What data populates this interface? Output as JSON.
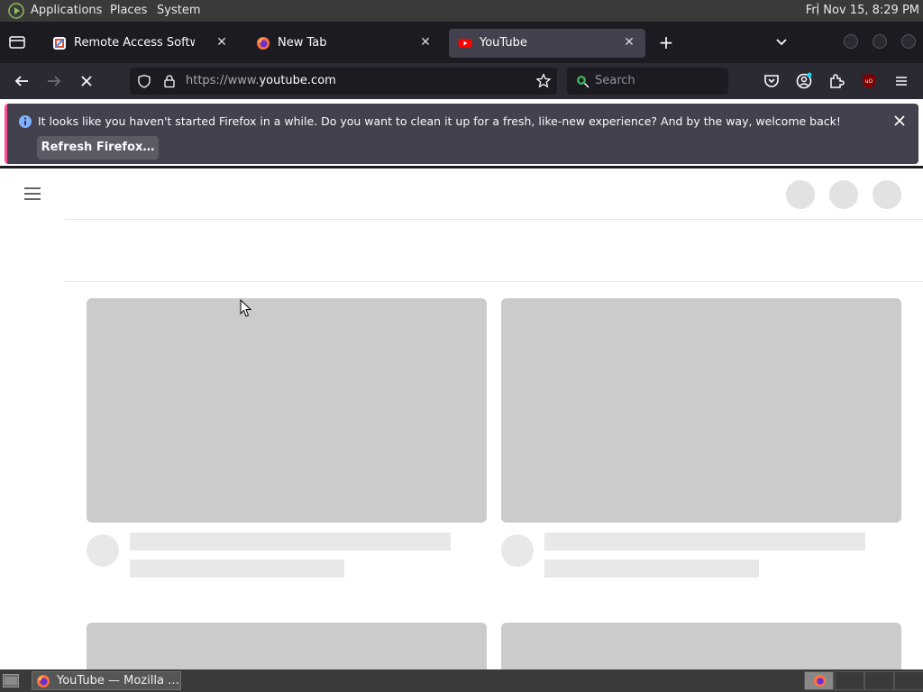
{
  "top_panel": {
    "menus": [
      "Applications",
      "Places",
      "System"
    ],
    "clock": "Fri Nov 15,  8:29 PM"
  },
  "tabs": [
    {
      "title": "Remote Access Software | F",
      "icon": "remote-access-favicon",
      "active": false
    },
    {
      "title": "New Tab",
      "icon": "firefox-icon",
      "active": false
    },
    {
      "title": "YouTube",
      "icon": "youtube-icon",
      "active": true
    }
  ],
  "toolbar": {
    "url_prefix": "https://www.",
    "url_domain": "youtube.com",
    "search_placeholder": "Search"
  },
  "notification": {
    "message": "It looks like you haven't started Firefox in a while. Do you want to clean it up for a fresh, like-new experience? And by the way, welcome back!",
    "button": "Refresh Firefox…"
  },
  "taskbar": {
    "window_title": "YouTube — Mozilla …"
  },
  "colors": {
    "accent": "#ff4f9a",
    "skeleton_thumb": "#cbcbcb",
    "skeleton_line": "#e8e8e8",
    "youtube_red": "#ff0000"
  }
}
